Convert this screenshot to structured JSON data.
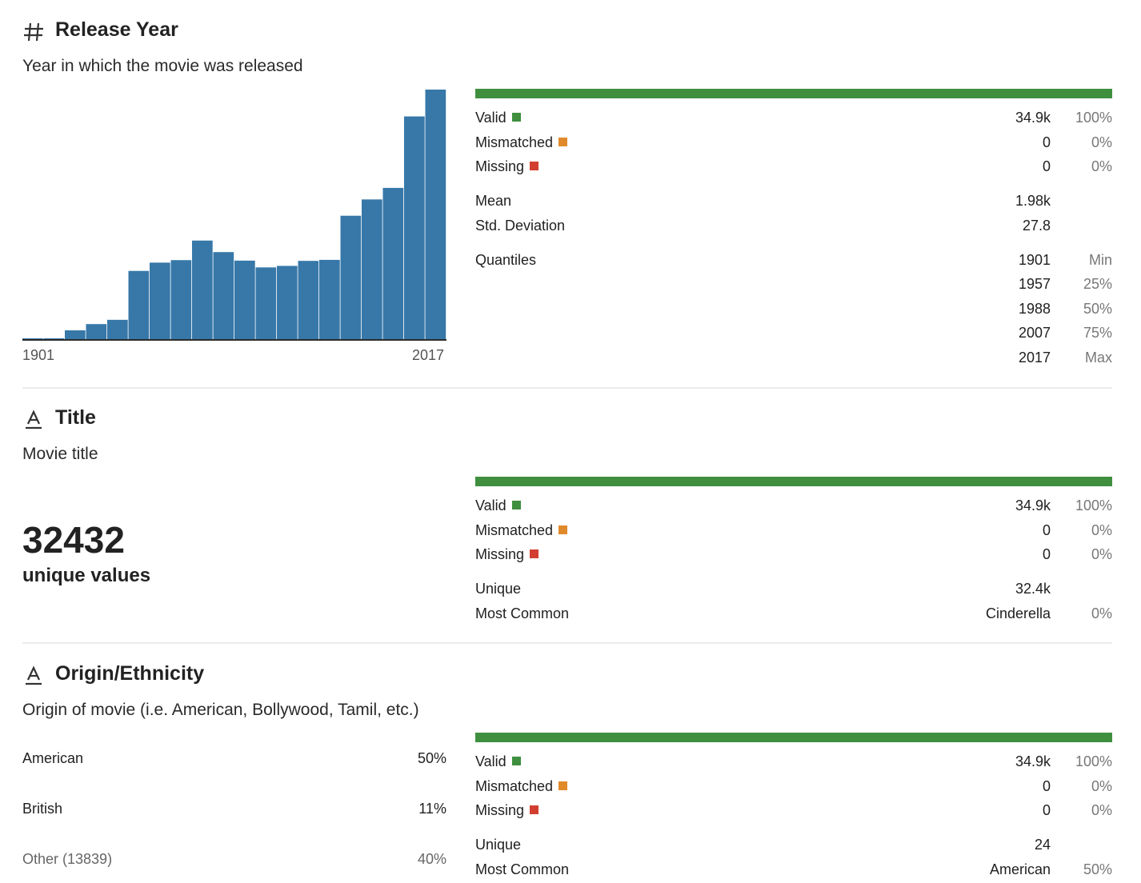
{
  "colors": {
    "valid": "#3f8f3f",
    "mismatched": "#e08a2c",
    "missing": "#d23f31",
    "histogram": "#3778a8"
  },
  "sections": [
    {
      "icon": "hash-icon",
      "title": "Release Year",
      "description": "Year in which the movie was released",
      "quality": {
        "valid": {
          "label": "Valid",
          "value": "34.9k",
          "pct": "100%"
        },
        "mismatched": {
          "label": "Mismatched",
          "value": "0",
          "pct": "0%"
        },
        "missing": {
          "label": "Missing",
          "value": "0",
          "pct": "0%"
        }
      },
      "stats": {
        "mean": {
          "label": "Mean",
          "value": "1.98k"
        },
        "std": {
          "label": "Std. Deviation",
          "value": "27.8"
        },
        "quantiles_label": "Quantiles",
        "quantiles": [
          {
            "value": "1901",
            "label": "Min"
          },
          {
            "value": "1957",
            "label": "25%"
          },
          {
            "value": "1988",
            "label": "50%"
          },
          {
            "value": "2007",
            "label": "75%"
          },
          {
            "value": "2017",
            "label": "Max"
          }
        ]
      },
      "histogram": {
        "x_min_label": "1901",
        "x_max_label": "2017",
        "counts": [
          1,
          3,
          35,
          60,
          77,
          272,
          305,
          315,
          393,
          347,
          313,
          286,
          292,
          312,
          316,
          492,
          557,
          603,
          888,
          995
        ]
      }
    },
    {
      "icon": "text-type-icon",
      "title": "Title",
      "description": "Movie title",
      "big_number": "32432",
      "big_number_label": "unique values",
      "quality": {
        "valid": {
          "label": "Valid",
          "value": "34.9k",
          "pct": "100%"
        },
        "mismatched": {
          "label": "Mismatched",
          "value": "0",
          "pct": "0%"
        },
        "missing": {
          "label": "Missing",
          "value": "0",
          "pct": "0%"
        }
      },
      "stats": {
        "unique": {
          "label": "Unique",
          "value": "32.4k"
        },
        "most_common": {
          "label": "Most Common",
          "value": "Cinderella",
          "pct": "0%"
        }
      }
    },
    {
      "icon": "text-type-icon",
      "title": "Origin/Ethnicity",
      "description": "Origin of movie (i.e. American, Bollywood, Tamil, etc.)",
      "categories": [
        {
          "label": "American",
          "pct": "50%"
        },
        {
          "label": "British",
          "pct": "11%"
        },
        {
          "label": "Other (13839)",
          "pct": "40%"
        }
      ],
      "quality": {
        "valid": {
          "label": "Valid",
          "value": "34.9k",
          "pct": "100%"
        },
        "mismatched": {
          "label": "Mismatched",
          "value": "0",
          "pct": "0%"
        },
        "missing": {
          "label": "Missing",
          "value": "0",
          "pct": "0%"
        }
      },
      "stats": {
        "unique": {
          "label": "Unique",
          "value": "24"
        },
        "most_common": {
          "label": "Most Common",
          "value": "American",
          "pct": "50%"
        }
      }
    }
  ]
}
